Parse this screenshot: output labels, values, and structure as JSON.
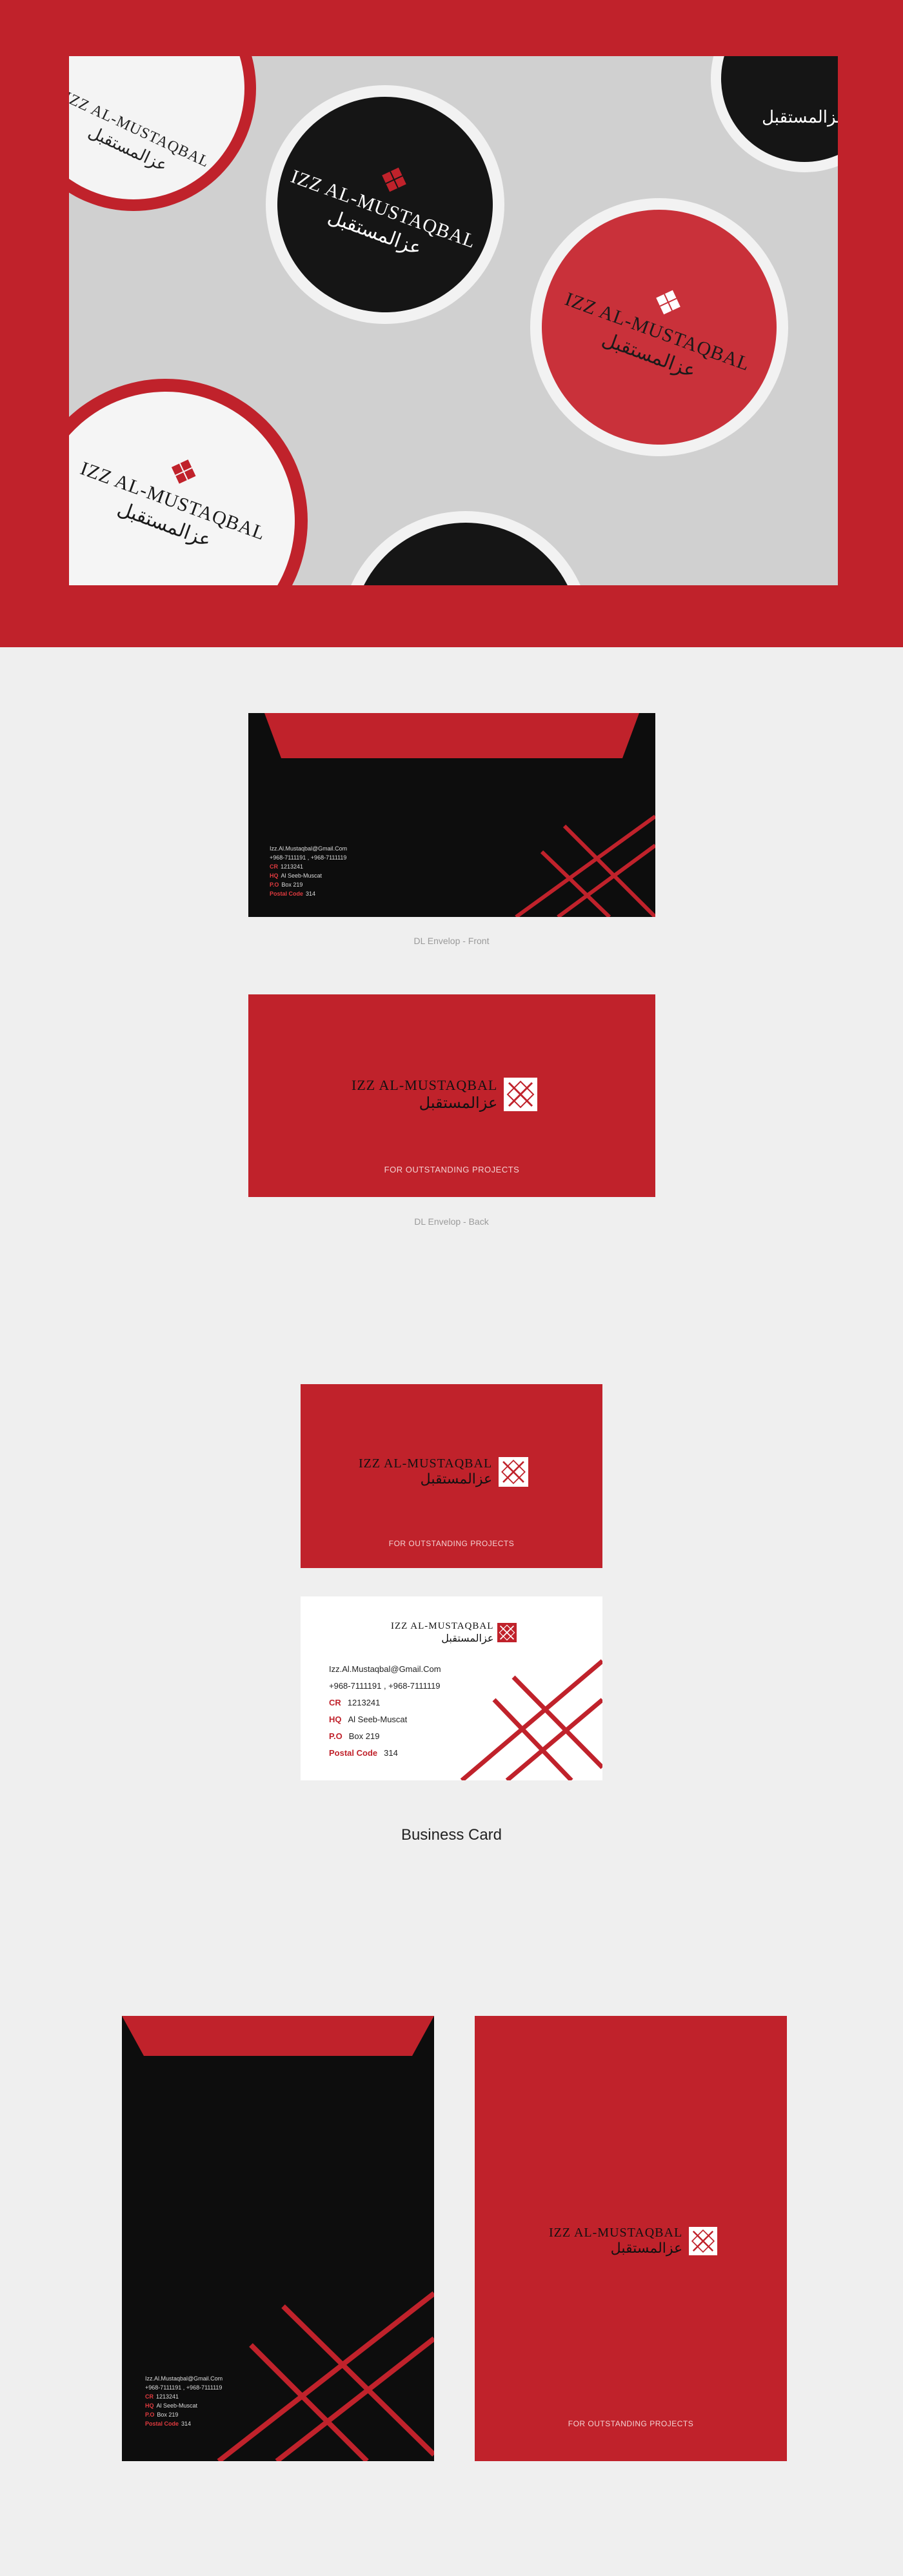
{
  "brand": {
    "name_en": "IZZ AL-MUSTAQBAL",
    "name_ar": "عزالمستقبل",
    "tagline": "FOR OUTSTANDING PROJECTS",
    "colors": {
      "red": "#c0222b",
      "black": "#0d0d0d",
      "white": "#ffffff",
      "gray": "#efefef"
    }
  },
  "hero": {
    "icons": [
      "logo-diamond-icon"
    ]
  },
  "envelope_front": {
    "caption": "DL Envelop - Front",
    "contact": {
      "email": "Izz.Al.Mustaqbal@Gmail.Com",
      "phones": "+968-7111191 , +968-7111119",
      "cr_label": "CR",
      "cr_value": "1213241",
      "hq_label": "HQ",
      "hq_value": "Al Seeb-Muscat",
      "po_label": "P.O",
      "po_value": "Box 219",
      "postal_label": "Postal Code",
      "postal_value": "314"
    }
  },
  "envelope_back": {
    "caption": "DL Envelop - Back"
  },
  "business_card": {
    "caption": "Business Card",
    "contact": {
      "email": "Izz.Al.Mustaqbal@Gmail.Com",
      "phones": "+968-7111191 , +968-7111119",
      "cr_label": "CR",
      "cr_value": "1213241",
      "hq_label": "HQ",
      "hq_value": "Al Seeb-Muscat",
      "po_label": "P.O",
      "po_value": "Box 219",
      "postal_label": "Postal Code",
      "postal_value": "314"
    }
  },
  "large_envelope": {
    "contact": {
      "email": "Izz.Al.Mustaqbal@Gmail.Com",
      "phones": "+968-7111191 , +968-7111119",
      "cr_label": "CR",
      "cr_value": "1213241",
      "hq_label": "HQ",
      "hq_value": "Al Seeb-Muscat",
      "po_label": "P.O",
      "po_value": "Box 219",
      "postal_label": "Postal Code",
      "postal_value": "314"
    }
  }
}
